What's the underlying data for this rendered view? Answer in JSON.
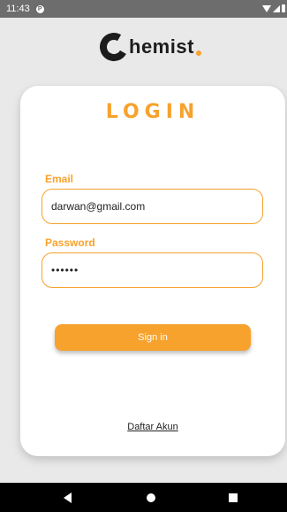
{
  "status_bar": {
    "time": "11:43",
    "notification_glyph": "P"
  },
  "logo": {
    "text": "hemist"
  },
  "login_card": {
    "title": "LOGIN",
    "email_label": "Email",
    "email_value": "darwan@gmail.com",
    "password_label": "Password",
    "password_value": "••••••",
    "signin_label": "Sign in",
    "register_link": "Daftar Akun"
  },
  "colors": {
    "accent": "#f7a22d",
    "background": "#e9e9e9",
    "card": "#ffffff",
    "status_bar": "#6d6d6d",
    "nav_bar": "#000000"
  },
  "icons": {
    "status": [
      "notification-icon",
      "wifi-icon",
      "signal-icon",
      "battery-icon"
    ],
    "navigation": [
      "back-icon",
      "home-icon",
      "recents-icon"
    ]
  }
}
